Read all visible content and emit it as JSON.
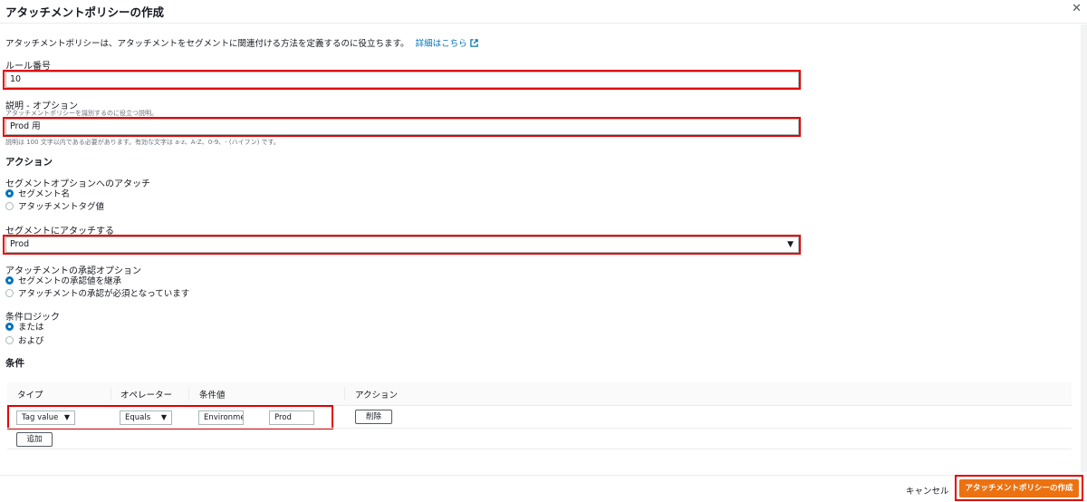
{
  "modal": {
    "title": "アタッチメントポリシーの作成",
    "close": "✕",
    "description": "アタッチメントポリシーは、アタッチメントをセグメントに関連付ける方法を定義するのに役立ちます。",
    "learn_more": "詳細はこちら"
  },
  "rule": {
    "label": "ルール番号",
    "value": "10"
  },
  "description_field": {
    "label": "説明 - オプション",
    "hint": "アタッチメントポリシーを識別するのに役立つ説明。",
    "value": "Prod 用",
    "constraint": "説明は 100 文字以内である必要があります。有効な文字は a-z、A-Z、0-9、- (ハイフン) です。"
  },
  "actions": {
    "heading": "アクション",
    "attach_option_label": "セグメントオプションへのアタッチ",
    "attach_options": [
      "セグメント名",
      "アタッチメントタグ値"
    ],
    "attach_selected": 0,
    "segment_label": "セグメントにアタッチする",
    "segment_value": "Prod",
    "approval_label": "アタッチメントの承認オプション",
    "approval_options": [
      "セグメントの承認値を継承",
      "アタッチメントの承認が必須となっています"
    ],
    "approval_selected": 0,
    "logic_label": "条件ロジック",
    "logic_options": [
      "または",
      "および"
    ],
    "logic_selected": 0
  },
  "conditions": {
    "heading": "条件",
    "columns": [
      "タイプ",
      "オペレーター",
      "条件値",
      "アクション"
    ],
    "row": {
      "type": "Tag value",
      "operator": "Equals",
      "key": "Environme",
      "value": "Prod",
      "delete": "削除"
    },
    "add": "追加"
  },
  "footer": {
    "cancel": "キャンセル",
    "submit": "アタッチメントポリシーの作成"
  },
  "colors": {
    "primary": "#ec7211",
    "link": "#0073bb",
    "highlight": "#e30000"
  }
}
